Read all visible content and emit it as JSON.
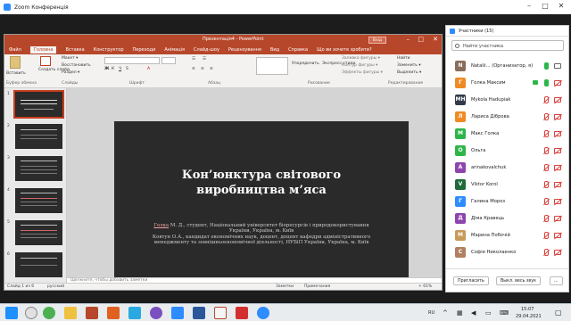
{
  "zoom": {
    "window_title": "Zoom Конференція"
  },
  "ppt": {
    "doc_title": "Презентація4 - PowerPoint",
    "login_label": "Вхід",
    "tabs": [
      "Файл",
      "Головна",
      "Вставка",
      "Конструктор",
      "Переходи",
      "Анімація",
      "Слайд-шоу",
      "Рецензування",
      "Вид",
      "Справка",
      "Що ви хочете зробити?"
    ],
    "ribbon": {
      "paste": "Вставить",
      "create_slide": "Создать слайд",
      "macet": "Макет ▾",
      "reset": "Восстановить",
      "section": "Раздел ▾",
      "group_clipboard": "Буфер обмена",
      "group_slides": "Слайды",
      "group_font": "Шрифт",
      "group_para": "Абзац",
      "group_drawing": "Рисование",
      "group_edit": "Редактирование",
      "arrange": "Упорядочить",
      "express_styles": "Экспресс-стили",
      "shape_fill": "Заливка фигуры ▾",
      "shape_outline": "Контур фигуры ▾",
      "shape_effects": "Эффекты фигуры ▾",
      "find": "Найти",
      "replace": "Заменить ▾",
      "select": "Выделить ▾"
    },
    "thumb_numbers": [
      "1",
      "2",
      "3",
      "4",
      "5",
      "6"
    ],
    "slide": {
      "title_line1": "Кон’юнктура світового",
      "title_line2": "виробництва м’яса",
      "author1_name": "Голка",
      "author1_rest": " М. Д., студент, Національний університет біоресурсів і природокористування України, Україна, м. Київ",
      "author2": "Ковтун О.А., кандидат економічних наук, доцент, доцент кафедри адміністративного менеджменту та зовнішньоекономічної діяльності, НУБіП України, Україна, м. Київ"
    },
    "notes_placeholder": "Щелкните, чтобы добавить заметки",
    "status": {
      "slide_of": "Слайд 1 из 6",
      "lang": "русский",
      "notes": "Заметки",
      "comments": "Примечания",
      "zoom": "+ 61%"
    }
  },
  "participants": {
    "header": "Участники (15)",
    "search_placeholder": "Найти участника",
    "list": [
      {
        "initial": "N",
        "name": "Nataliі... (Организатор, я)",
        "color": "#8a6d5a",
        "mic": "on",
        "cam": "on",
        "video": false
      },
      {
        "initial": "Г",
        "name": "Голка Максим",
        "color": "#f08a24",
        "mic": "on",
        "cam": "off",
        "video": true
      },
      {
        "initial": "MH",
        "name": "Mykola Hadupiak",
        "color": "#333b4a",
        "mic": "muted",
        "cam": "off",
        "video": false
      },
      {
        "initial": "Л",
        "name": "Лариса Діброва",
        "color": "#f08a24",
        "mic": "muted",
        "cam": "off",
        "video": false
      },
      {
        "initial": "М",
        "name": "Макс Голка",
        "color": "#2db54a",
        "mic": "muted",
        "cam": "off",
        "video": false
      },
      {
        "initial": "О",
        "name": "Ольга",
        "color": "#2db54a",
        "mic": "muted",
        "cam": "off",
        "video": false
      },
      {
        "initial": "A",
        "name": "arinakovalchuk",
        "color": "#8e44ad",
        "mic": "muted",
        "cam": "off",
        "video": false
      },
      {
        "initial": "V",
        "name": "Viktor Korol",
        "color": "#1f6b3a",
        "mic": "muted",
        "cam": "off",
        "video": false
      },
      {
        "initial": "Г",
        "name": "Галина Мороз",
        "color": "#2d8cff",
        "mic": "muted",
        "cam": "off",
        "video": false
      },
      {
        "initial": "Д",
        "name": "Діма Кравець",
        "color": "#8e44ad",
        "mic": "muted",
        "cam": "off",
        "video": false
      },
      {
        "initial": "М",
        "name": "Марина Побочій",
        "color": "#c89a5a",
        "mic": "muted",
        "cam": "off",
        "video": false
      },
      {
        "initial": "С",
        "name": "Софія Николаенко",
        "color": "#b08060",
        "mic": "muted",
        "cam": "off",
        "video": false
      }
    ],
    "invite_label": "Пригласить",
    "mute_all_label": "Выкл. весь звук",
    "more_label": "..."
  },
  "taskbar": {
    "lang": "RU",
    "time": "15:07",
    "date": "29.04.2021"
  }
}
